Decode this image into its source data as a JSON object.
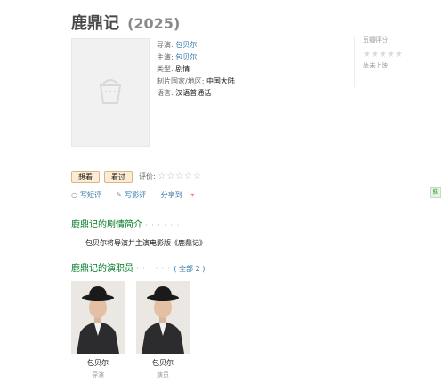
{
  "header": {
    "title": "鹿鼎记",
    "year": "(2025)"
  },
  "info": {
    "director_label": "导演:",
    "director": "包贝尔",
    "star_label": "主演:",
    "star": "包贝尔",
    "genre_label": "类型:",
    "genre": "剧情",
    "country_label": "制片国家/地区:",
    "country": "中国大陆",
    "language_label": "语言:",
    "language": "汉语普通话"
  },
  "rating": {
    "title": "豆瓣评分",
    "stars": "★★★★★",
    "status": "尚未上映"
  },
  "buttons": {
    "want": "想看",
    "seen": "看过"
  },
  "user_rating": {
    "label": "评价:",
    "stars": "☆☆☆☆☆"
  },
  "actions": {
    "short_review": "写短评",
    "review": "写影评",
    "share": "分享到",
    "share_arrow": "▾"
  },
  "side_tab": "推",
  "synopsis_section": {
    "title": "鹿鼎记的剧情简介",
    "dots": "· · · · · ·"
  },
  "synopsis": "包贝尔将导演并主演电影版《鹿鼎记》",
  "cast_section": {
    "title": "鹿鼎记的演职员",
    "dots": "· · · · · ·",
    "all": "( 全部 2 )"
  },
  "cast": [
    {
      "name": "包贝尔",
      "role": "导演"
    },
    {
      "name": "包贝尔",
      "role": "演员"
    }
  ],
  "colors": {
    "link": "#3377aa",
    "section": "#007722",
    "button_bg": "#fdebd3"
  }
}
